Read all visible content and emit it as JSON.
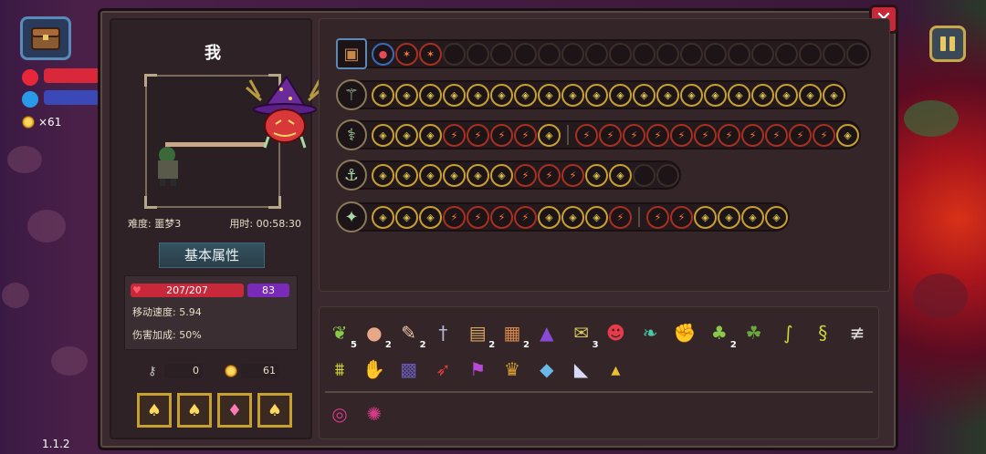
{
  "hud": {
    "coins": "×61",
    "version": "1.1.2",
    "colors": {
      "hp": "#d8283a",
      "mana": "#3a48b8",
      "coin": "#ffd860"
    }
  },
  "panel": {
    "player_name": "我",
    "difficulty": "难度: 噩梦3",
    "time": "用时: 00:58:30",
    "attr_title": "基本属性",
    "hp": "207/207",
    "shield": "83",
    "move_speed": "移动速度: 5.94",
    "damage_bonus": "伤害加成: 50%",
    "keys": "0",
    "gold": "61",
    "consumables": [
      "potion-yellow",
      "potion-yellow",
      "potion-pink",
      "potion-yellow"
    ]
  },
  "weapon_rows": [
    {
      "icon": "chest-icon",
      "slots": [
        "blue",
        "red",
        "red",
        "",
        "",
        "",
        "",
        "",
        "",
        "",
        "",
        "",
        "",
        "",
        "",
        "",
        "",
        "",
        "",
        "",
        ""
      ],
      "sep_after": -1
    },
    {
      "icon": "staff-icon",
      "slots": [
        "b",
        "b",
        "b",
        "b",
        "b",
        "b",
        "b",
        "b",
        "b",
        "b",
        "b",
        "b",
        "b",
        "b",
        "b",
        "b",
        "b",
        "b",
        "b",
        "b"
      ],
      "sep_after": -1
    },
    {
      "icon": "wand-icon",
      "slots": [
        "b",
        "b",
        "b",
        "r",
        "r",
        "r",
        "r",
        "b",
        "r",
        "r",
        "r",
        "r",
        "r",
        "r",
        "r",
        "r",
        "r",
        "r",
        "r",
        "b"
      ],
      "sep_after": 7
    },
    {
      "icon": "trident-icon",
      "slots": [
        "b",
        "b",
        "b",
        "b",
        "b",
        "b",
        "r",
        "r",
        "r",
        "b",
        "b",
        "",
        ""
      ],
      "sep_after": -1
    },
    {
      "icon": "scepter-icon",
      "slots": [
        "b",
        "b",
        "b",
        "r",
        "r",
        "r",
        "r",
        "b",
        "b",
        "b",
        "r",
        "r",
        "r",
        "b",
        "b",
        "b",
        "b"
      ],
      "sep_after": 10
    }
  ],
  "passives_row1": [
    {
      "icon": "vine-icon",
      "count": "5"
    },
    {
      "icon": "seed-icon",
      "count": "2"
    },
    {
      "icon": "feather-icon",
      "count": "2"
    },
    {
      "icon": "dagger-icon",
      "count": ""
    },
    {
      "icon": "book-icon",
      "count": "2"
    },
    {
      "icon": "crate-icon",
      "count": "2"
    },
    {
      "icon": "witch-hat-icon",
      "count": ""
    },
    {
      "icon": "scroll-icon",
      "count": "3"
    },
    {
      "icon": "demon-mask-icon",
      "count": ""
    },
    {
      "icon": "leaf-icon",
      "count": ""
    },
    {
      "icon": "gauntlet-icon",
      "count": ""
    },
    {
      "icon": "sprout-icon",
      "count": "2"
    },
    {
      "icon": "frog-icon",
      "count": ""
    },
    {
      "icon": "snake-icon",
      "count": ""
    },
    {
      "icon": "worm-icon",
      "count": ""
    },
    {
      "icon": "fish-bone-icon",
      "count": ""
    }
  ],
  "passives_row2": [
    {
      "icon": "teeth-icon",
      "count": ""
    },
    {
      "icon": "claw-icon",
      "count": ""
    },
    {
      "icon": "cage-icon",
      "count": ""
    },
    {
      "icon": "bird-icon",
      "count": ""
    },
    {
      "icon": "flag-icon",
      "count": ""
    },
    {
      "icon": "trophy-icon",
      "count": ""
    },
    {
      "icon": "crystal-icon",
      "count": ""
    },
    {
      "icon": "horn-icon",
      "count": ""
    },
    {
      "icon": "gold-pile-icon",
      "count": ""
    }
  ],
  "passives_row3": [
    {
      "icon": "swirl-orb-icon",
      "count": ""
    },
    {
      "icon": "spiked-orb-icon",
      "count": ""
    }
  ]
}
